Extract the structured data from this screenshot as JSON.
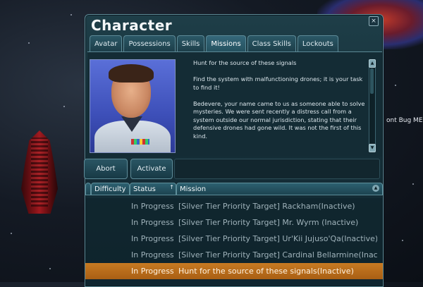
{
  "window": {
    "title": "Character",
    "close_label": "×"
  },
  "background": {
    "right_label": "ont Bug ME"
  },
  "tabs": [
    {
      "label": "Avatar",
      "active": false
    },
    {
      "label": "Possessions",
      "active": false
    },
    {
      "label": "Skills",
      "active": false
    },
    {
      "label": "Missions",
      "active": true
    },
    {
      "label": "Class Skills",
      "active": false
    },
    {
      "label": "Lockouts",
      "active": false
    }
  ],
  "mission_detail": {
    "paragraphs": [
      "Hunt for the source of these signals",
      "Find the system with malfunctioning drones; it is your task to find it!",
      "Bedevere, your name came to us as someone able to solve mysteries. We were sent recently a distress call from a system outside our normal jurisdiction, stating that their defensive drones had gone wild. It was not the first of this kind."
    ],
    "scroll_up": "▲",
    "scroll_down": "▼"
  },
  "buttons": {
    "abort": "Abort",
    "activate": "Activate"
  },
  "table": {
    "columns": {
      "difficulty": "Difficulty",
      "status": "Status",
      "mission": "Mission"
    },
    "sort_indicator": "↑",
    "scroll_up": "▲",
    "rows": [
      {
        "status": "In Progress",
        "mission": "[Silver Tier Priority Target] Rackham(Inactive)",
        "selected": false
      },
      {
        "status": "In Progress",
        "mission": "[Silver Tier Priority Target] Mr. Wyrm (Inactive)",
        "selected": false
      },
      {
        "status": "In Progress",
        "mission": "[Silver Tier Priority Target] Ur'Kii Jujuso'Qa(Inactive)",
        "selected": false
      },
      {
        "status": "In Progress",
        "mission": "[Silver Tier Priority Target] Cardinal Bellarmine(Inactive",
        "selected": false
      },
      {
        "status": "In Progress",
        "mission": "Hunt for the source of these signals(Inactive)",
        "selected": true
      }
    ]
  },
  "colors": {
    "window_bg": "#163039",
    "accent_border": "#5e8c99",
    "selected_row": "#c77a22"
  }
}
